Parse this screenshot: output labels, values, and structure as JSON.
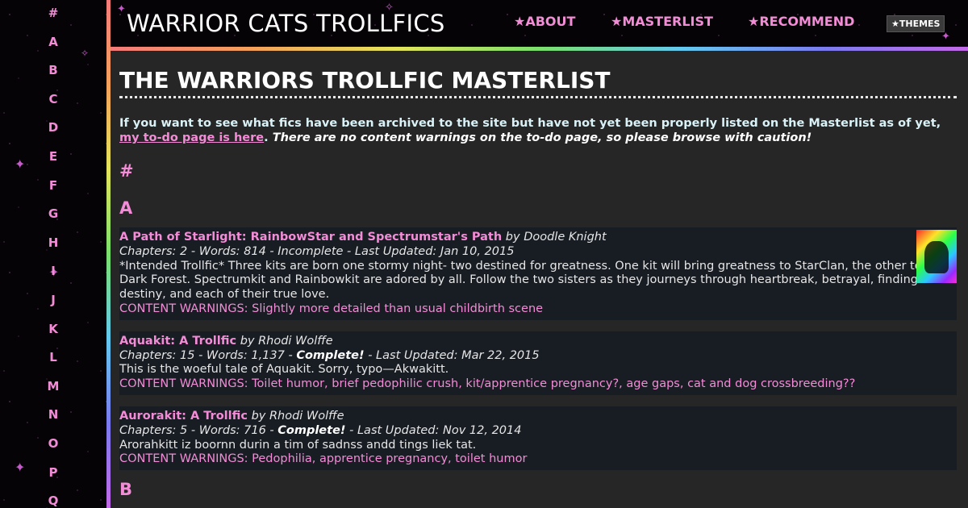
{
  "sidebar": {
    "letters": [
      "#",
      "A",
      "B",
      "C",
      "D",
      "E",
      "F",
      "G",
      "H",
      "I",
      "J",
      "K",
      "L",
      "M",
      "N",
      "O",
      "P",
      "Q"
    ]
  },
  "header": {
    "site_title": "WARRIOR CATS TROLLFICS",
    "nav": {
      "about": "★ABOUT",
      "masterlist": "★MASTERLIST",
      "recommend": "★RECOMMEND",
      "themes": "★THEMES"
    }
  },
  "main": {
    "title": "THE WARRIORS TROLLFIC MASTERLIST",
    "intro": {
      "text_before": "If you want to see what fics have been archived to the site but have not yet been properly listed on the Masterlist as of yet, ",
      "link": "my to-do page is here",
      "text_after": ". ",
      "warning": "There are no content warnings on the to-do page, so please browse with caution!"
    },
    "sections": {
      "hash": "#",
      "a": "A",
      "b": "B"
    },
    "entries": [
      {
        "title": "A Path of Starlight: RainbowStar and Spectrumstar's Path",
        "author": "by Doodle Knight",
        "meta": "Chapters: 2 - Words: 814 - Incomplete - Last Updated: Jan 10, 2015",
        "summary": "*Intended Trollfic* Three kits are born one stormy night- two destined for greatness. One kit will bring greatness to StarClan, the other to the Dark Forest. Spectrumkit and Rainbowkit are adored by all. Follow the two sisters as they journeys through heartbreak, betrayal, finding their destiny, and each of their true love.",
        "warnings": "CONTENT WARNINGS: Slightly more detailed than usual childbirth scene"
      },
      {
        "title": "Aquakit: A Trollfic",
        "author": "by Rhodi Wolffe",
        "meta_before": "Chapters: 15 - Words: 1,137 - ",
        "meta_status": "Complete!",
        "meta_after": " - Last Updated: Mar 22, 2015",
        "summary": "This is the woeful tale of Aquakit. Sorry, typo—Akwakitt.",
        "warnings": "CONTENT WARNINGS: Toilet humor, brief pedophilic crush, kit/apprentice pregnancy?, age gaps, cat and dog crossbreeding??"
      },
      {
        "title": "Aurorakit: A Trollfic",
        "author": "by Rhodi Wolffe",
        "meta_before": "Chapters: 5 - Words: 716 - ",
        "meta_status": "Complete!",
        "meta_after": " - Last Updated: Nov 12, 2014",
        "summary": "Arorahkitt iz boornn durin a tim of sadnss andd tings liek tat.",
        "warnings": "CONTENT WARNINGS: Pedophilia, apprentice pregnancy, toilet humor"
      }
    ]
  },
  "colors": {
    "accent_pink": "#f38cd6",
    "intro_text": "#d9f2f7",
    "content_bg": "#262626",
    "entry_bg": "#181c23"
  },
  "icons": {
    "sparkle": "sparkle-icon",
    "cover": "fic-cover-thumbnail"
  }
}
